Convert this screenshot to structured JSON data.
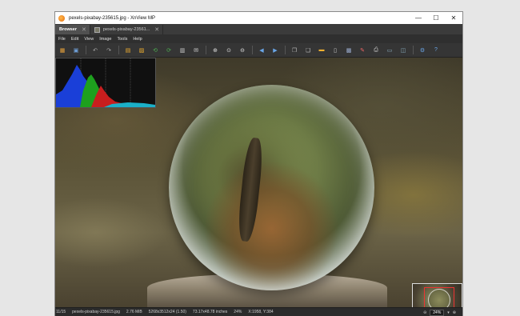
{
  "window": {
    "title": "pexels-pixabay-235615.jpg - XnView MP",
    "controls": {
      "minimize": "—",
      "maximize": "☐",
      "close": "✕"
    }
  },
  "tabs": [
    {
      "label": "Browser",
      "close": "✕",
      "active": true
    },
    {
      "label": "pexels-pixabay-23561...",
      "close": "✕",
      "active": false
    }
  ],
  "menu": [
    "File",
    "Edit",
    "View",
    "Image",
    "Tools",
    "Help"
  ],
  "toolbar_icons": [
    {
      "name": "browser-icon",
      "glyph": "▦",
      "color": "#e8a33a"
    },
    {
      "name": "save-icon",
      "glyph": "▣",
      "color": "#6fa0d8"
    },
    {
      "name": "undo-icon",
      "glyph": "↶",
      "color": "#aaaaaa"
    },
    {
      "name": "redo-icon",
      "glyph": "↷",
      "color": "#aaaaaa"
    },
    {
      "name": "crop-icon",
      "glyph": "▤",
      "color": "#f0b030"
    },
    {
      "name": "resize-icon",
      "glyph": "▨",
      "color": "#f0b030"
    },
    {
      "name": "rotate-left-icon",
      "glyph": "⟲",
      "color": "#4caf50"
    },
    {
      "name": "rotate-right-icon",
      "glyph": "⟳",
      "color": "#4caf50"
    },
    {
      "name": "adjust-icon",
      "glyph": "▥",
      "color": "#cccccc"
    },
    {
      "name": "email-icon",
      "glyph": "✉",
      "color": "#dddddd"
    },
    {
      "name": "zoom-in-icon",
      "glyph": "⊕",
      "color": "#dddddd"
    },
    {
      "name": "zoom-fit-icon",
      "glyph": "⊙",
      "color": "#dddddd"
    },
    {
      "name": "zoom-out-icon",
      "glyph": "⊖",
      "color": "#dddddd"
    },
    {
      "name": "previous-icon",
      "glyph": "◀",
      "color": "#6aa6e8"
    },
    {
      "name": "next-icon",
      "glyph": "▶",
      "color": "#6aa6e8"
    },
    {
      "name": "copy-icon",
      "glyph": "❐",
      "color": "#bbbbbb"
    },
    {
      "name": "paste-icon",
      "glyph": "❏",
      "color": "#bbbbbb"
    },
    {
      "name": "folder-icon",
      "glyph": "▬",
      "color": "#f0b030"
    },
    {
      "name": "document-icon",
      "glyph": "▯",
      "color": "#cccccc"
    },
    {
      "name": "slideshow-icon",
      "glyph": "▩",
      "color": "#9ac"
    },
    {
      "name": "paint-icon",
      "glyph": "✎",
      "color": "#e66"
    },
    {
      "name": "print-icon",
      "glyph": "⎙",
      "color": "#cccccc"
    },
    {
      "name": "scanner-icon",
      "glyph": "▭",
      "color": "#8ab"
    },
    {
      "name": "compare-icon",
      "glyph": "◫",
      "color": "#8ab"
    },
    {
      "name": "settings-icon",
      "glyph": "⚙",
      "color": "#6aa6e8"
    },
    {
      "name": "help-icon",
      "glyph": "?",
      "color": "#6aa6e8"
    }
  ],
  "status": {
    "index": "11/15",
    "filename": "pexels-pixabay-235615.jpg",
    "filesize": "2.76 MiB",
    "dimensions": "5268x3512x24 (1.50)",
    "physical": "73.17x48.78 inches",
    "zoom": "24%",
    "coords": "X:1958, Y:384",
    "zoom_box": "24%"
  }
}
